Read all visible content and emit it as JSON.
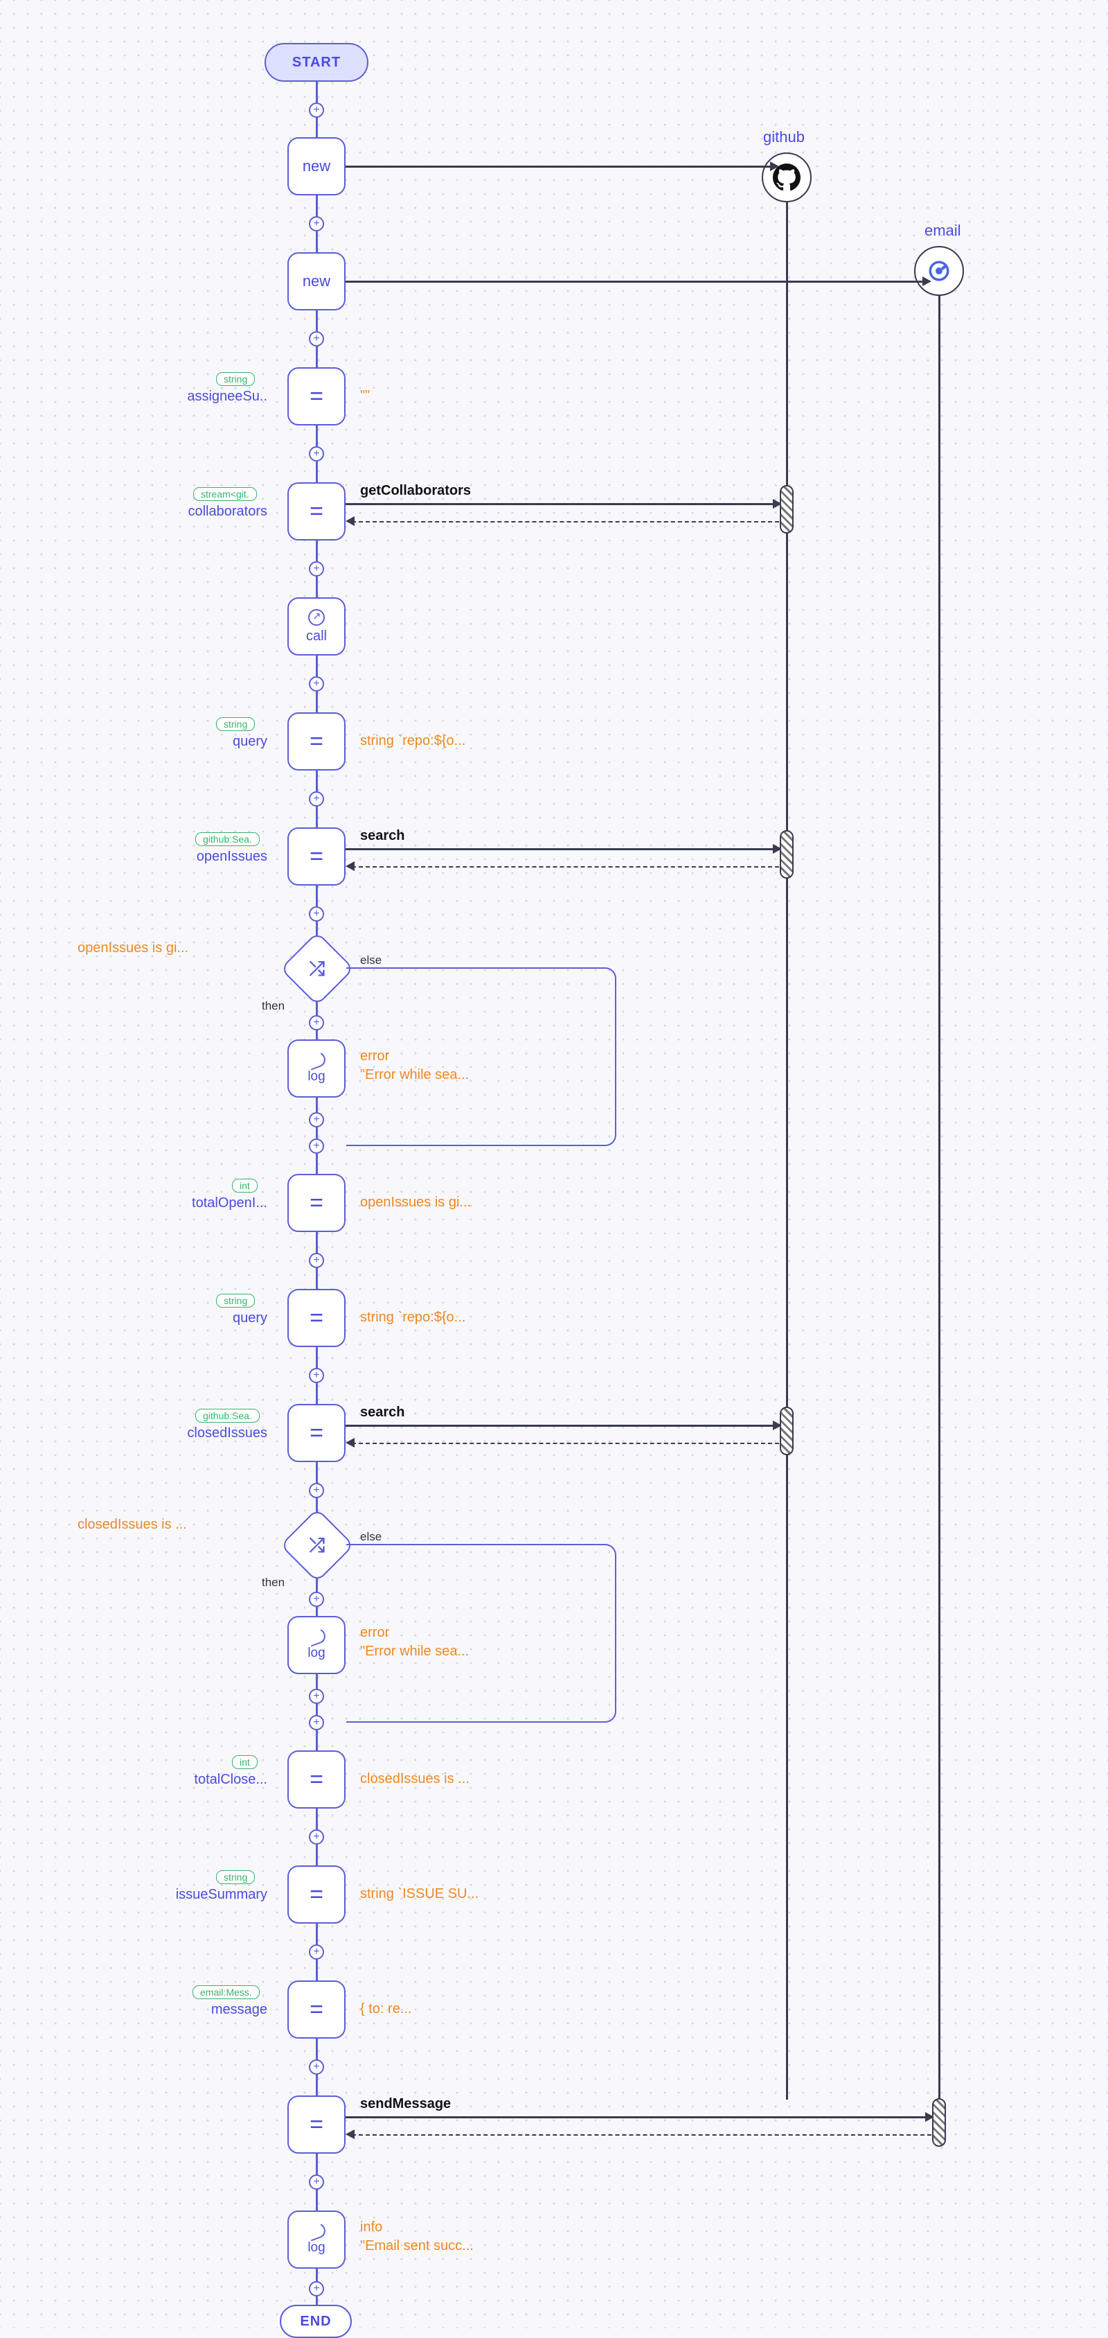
{
  "start_label": "START",
  "end_label": "END",
  "actors": {
    "github": {
      "label": "github"
    },
    "email": {
      "label": "email"
    }
  },
  "nodes": {
    "new1": "new",
    "new2": "new",
    "eq": "=",
    "call": "call",
    "log": "log"
  },
  "vars": {
    "assigneeSu": {
      "type": "string",
      "name": "assigneeSu..",
      "value": "\"\""
    },
    "collaborators": {
      "type": "stream<git.",
      "name": "collaborators",
      "call": "getCollaborators"
    },
    "query1": {
      "type": "string",
      "name": "query",
      "value": "string `repo:${o..."
    },
    "openIssues": {
      "type": "github:Sea.",
      "name": "openIssues",
      "call": "search"
    },
    "cond1": {
      "expr": "openIssues is gi...",
      "else": "else",
      "then": "then"
    },
    "log1": {
      "level": "error",
      "msg": "\"Error while sea..."
    },
    "totalOpenI": {
      "type": "int",
      "name": "totalOpenI...",
      "value": "openIssues is gi..."
    },
    "query2": {
      "type": "string",
      "name": "query",
      "value": "string `repo:${o..."
    },
    "closedIssues": {
      "type": "github:Sea.",
      "name": "closedIssues",
      "call": "search"
    },
    "cond2": {
      "expr": "closedIssues is ...",
      "else": "else",
      "then": "then"
    },
    "log2": {
      "level": "error",
      "msg": "\"Error while sea..."
    },
    "totalClose": {
      "type": "int",
      "name": "totalClose...",
      "value": "closedIssues is ..."
    },
    "issueSummary": {
      "type": "string",
      "name": "issueSummary",
      "value": "string `ISSUE SU..."
    },
    "message": {
      "type": "email:Mess.",
      "name": "message",
      "value": "{ to: re..."
    },
    "sendMessage": {
      "call": "sendMessage"
    },
    "log3": {
      "level": "info",
      "msg": "\"Email sent succ..."
    }
  }
}
